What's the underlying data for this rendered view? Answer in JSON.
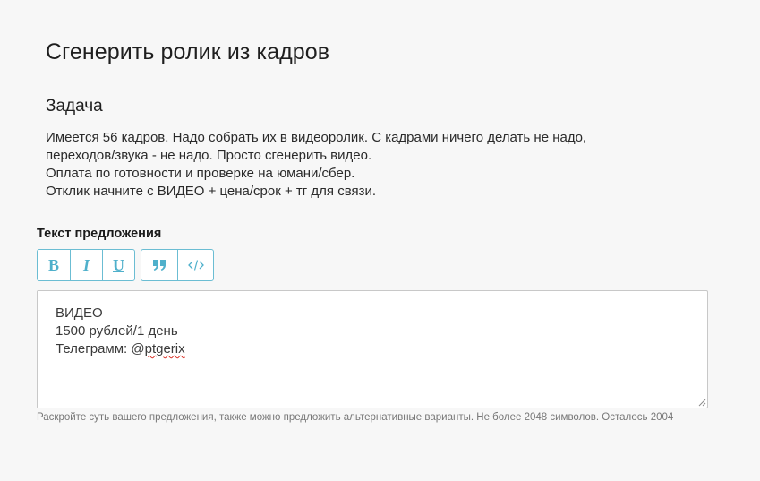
{
  "page": {
    "title": "Сгенерить ролик из кадров"
  },
  "task": {
    "heading": "Задача",
    "lines": [
      "Имеется 56 кадров. Надо собрать их в видеоролик. С кадрами ничего делать не надо,",
      "переходов/звука - не надо. Просто сгенерить видео.",
      "Оплата по готовности и проверке на юмани/сбер.",
      "Отклик начните с ВИДЕО + цена/срок + тг для связи."
    ]
  },
  "offer": {
    "label": "Текст предложения",
    "toolbar": {
      "bold": "B",
      "italic": "I",
      "underline": "U",
      "quote": "❞",
      "code": "</>"
    },
    "text": {
      "line1": "ВИДЕО",
      "line2": "1500 рублей/1 день",
      "line3_prefix": "Телеграмм: @",
      "line3_handle": "ptgerix"
    },
    "hint": "Раскройте суть вашего предложения, также можно предложить альтернативные варианты. Не более 2048 символов. Осталось 2004"
  },
  "colors": {
    "accent": "#4fb0cb",
    "border_accent": "#6bbdd3",
    "background": "#f7f7f7",
    "hint": "#777777"
  },
  "icons": {
    "quote": "quote-icon",
    "code": "code-icon",
    "resize": "resize-handle-icon"
  }
}
